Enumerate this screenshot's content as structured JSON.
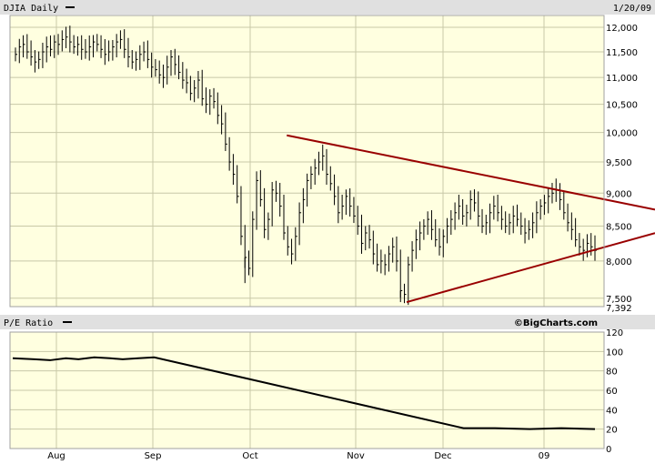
{
  "header": {
    "title": "DJIA Daily",
    "date": "1/20/09"
  },
  "pe_header": {
    "title": "P/E Ratio",
    "watermark": "©BigCharts.com"
  },
  "colors": {
    "panel_bg": "#ffffe0",
    "header_bg": "#e0e0e0",
    "grid": "#c8c8a8",
    "price_bar": "#000000",
    "trendline": "#990000",
    "pe_line": "#000000"
  },
  "chart_data": [
    {
      "type": "bar",
      "subtype": "ohlc",
      "title": "DJIA Daily",
      "y_scale": "log",
      "ylim": [
        7392,
        12250
      ],
      "yticks": [
        7500,
        8000,
        8500,
        9000,
        9500,
        10000,
        10500,
        11000,
        11500,
        12000
      ],
      "ytick_labels": [
        "7,500",
        "8,000",
        "8,500",
        "9,000",
        "9,500",
        "10,000",
        "10,500",
        "11,000",
        "11,500",
        "12,000"
      ],
      "ymin_label": "7,392",
      "x_tick_labels": [
        "Aug",
        "Sep",
        "Oct",
        "Nov",
        "Dec",
        "09"
      ],
      "grid": true,
      "daily_close_approx": [
        11450,
        11600,
        11650,
        11500,
        11400,
        11300,
        11350,
        11500,
        11600,
        11550,
        11700,
        11650,
        11750,
        11800,
        11700,
        11600,
        11650,
        11550,
        11500,
        11600,
        11700,
        11650,
        11550,
        11450,
        11500,
        11600,
        11700,
        11750,
        11550,
        11400,
        11300,
        11350,
        11450,
        11500,
        11350,
        11200,
        11150,
        11050,
        11000,
        11200,
        11400,
        11250,
        11100,
        10950,
        10900,
        10700,
        10800,
        10950,
        10600,
        10500,
        10650,
        10550,
        10300,
        10150,
        9800,
        9500,
        9300,
        8950,
        8350,
        8050,
        7900,
        8600,
        9200,
        8900,
        8450,
        8600,
        9050,
        9000,
        8800,
        8400,
        8200,
        8100,
        8350,
        8700,
        8900,
        9200,
        9300,
        9400,
        9500,
        9600,
        9300,
        9150,
        8950,
        8700,
        8800,
        8950,
        8800,
        8650,
        8500,
        8250,
        8400,
        8300,
        8100,
        7950,
        8000,
        7950,
        8100,
        8200,
        8000,
        7600,
        7550,
        7950,
        8150,
        8300,
        8400,
        8500,
        8600,
        8450,
        8300,
        8200,
        8350,
        8500,
        8600,
        8700,
        8800,
        8650,
        8700,
        8900,
        8850,
        8650,
        8500,
        8550,
        8700,
        8800,
        8700,
        8600,
        8500,
        8550,
        8650,
        8600,
        8500,
        8400,
        8450,
        8550,
        8700,
        8800,
        8850,
        8950,
        9000,
        9050,
        8900,
        8700,
        8550,
        8450,
        8300,
        8200,
        8150,
        8250,
        8200,
        8150
      ],
      "trendlines": [
        {
          "name": "upper",
          "points": [
            [
              "2008-10-13",
              9950
            ],
            [
              "2009-01-22",
              8900
            ]
          ]
        },
        {
          "name": "lower",
          "points": [
            [
              "2008-11-20",
              7450
            ],
            [
              "2009-01-22",
              8200
            ]
          ]
        }
      ]
    },
    {
      "type": "line",
      "title": "P/E Ratio",
      "ylim": [
        0,
        120
      ],
      "yticks": [
        0,
        20,
        40,
        60,
        80,
        100,
        120
      ],
      "ytick_labels": [
        "0",
        "20",
        "40",
        "60",
        "80",
        "100",
        "120"
      ],
      "x_tick_labels": [
        "Aug",
        "Sep",
        "Oct",
        "Nov",
        "Dec",
        "09"
      ],
      "grid": true,
      "points": [
        [
          "2008-07-21",
          93
        ],
        [
          "2008-07-25",
          92
        ],
        [
          "2008-07-30",
          91
        ],
        [
          "2008-08-04",
          93
        ],
        [
          "2008-08-08",
          92
        ],
        [
          "2008-08-13",
          94
        ],
        [
          "2008-08-18",
          93
        ],
        [
          "2008-08-22",
          92
        ],
        [
          "2008-08-27",
          93
        ],
        [
          "2008-09-01",
          94
        ],
        [
          "2008-12-08",
          21
        ],
        [
          "2008-12-18",
          21
        ],
        [
          "2008-12-29",
          20
        ],
        [
          "2009-01-08",
          21
        ],
        [
          "2009-01-20",
          20
        ]
      ]
    }
  ]
}
